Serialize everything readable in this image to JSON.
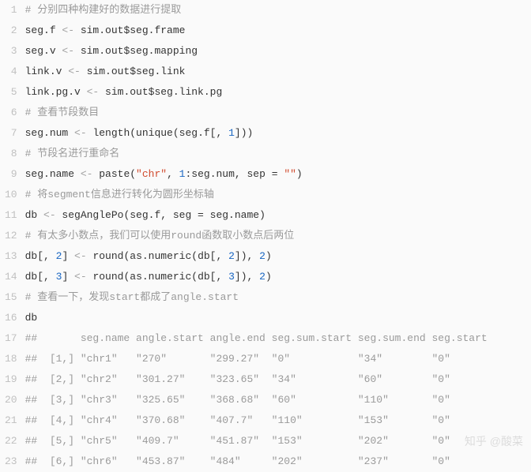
{
  "code": {
    "line_count": 23,
    "lines": [
      [
        {
          "t": "# 分别四种构建好的数据进行提取",
          "cls": "tok-comment"
        }
      ],
      [
        {
          "t": "seg.f ",
          "cls": "tok-ident"
        },
        {
          "t": "<-",
          "cls": "tok-op"
        },
        {
          "t": " sim.out$seg.frame",
          "cls": "tok-ident"
        }
      ],
      [
        {
          "t": "seg.v ",
          "cls": "tok-ident"
        },
        {
          "t": "<-",
          "cls": "tok-op"
        },
        {
          "t": " sim.out$seg.mapping",
          "cls": "tok-ident"
        }
      ],
      [
        {
          "t": "link.v ",
          "cls": "tok-ident"
        },
        {
          "t": "<-",
          "cls": "tok-op"
        },
        {
          "t": " sim.out$seg.link",
          "cls": "tok-ident"
        }
      ],
      [
        {
          "t": "link.pg.v ",
          "cls": "tok-ident"
        },
        {
          "t": "<-",
          "cls": "tok-op"
        },
        {
          "t": " sim.out$seg.link.pg",
          "cls": "tok-ident"
        }
      ],
      [
        {
          "t": "# 查看节段数目",
          "cls": "tok-comment"
        }
      ],
      [
        {
          "t": "seg.num ",
          "cls": "tok-ident"
        },
        {
          "t": "<-",
          "cls": "tok-op"
        },
        {
          "t": " length(unique(seg.f[, ",
          "cls": "tok-ident"
        },
        {
          "t": "1",
          "cls": "tok-num"
        },
        {
          "t": "]))",
          "cls": "tok-ident"
        }
      ],
      [
        {
          "t": "# 节段名进行重命名",
          "cls": "tok-comment"
        }
      ],
      [
        {
          "t": "seg.name ",
          "cls": "tok-ident"
        },
        {
          "t": "<-",
          "cls": "tok-op"
        },
        {
          "t": " paste(",
          "cls": "tok-ident"
        },
        {
          "t": "\"chr\"",
          "cls": "tok-str"
        },
        {
          "t": ", ",
          "cls": "tok-ident"
        },
        {
          "t": "1",
          "cls": "tok-num"
        },
        {
          "t": ":seg.num, sep = ",
          "cls": "tok-ident"
        },
        {
          "t": "\"\"",
          "cls": "tok-str"
        },
        {
          "t": ")",
          "cls": "tok-ident"
        }
      ],
      [
        {
          "t": "# 将segment信息进行转化为圆形坐标轴",
          "cls": "tok-comment"
        }
      ],
      [
        {
          "t": "db ",
          "cls": "tok-ident"
        },
        {
          "t": "<-",
          "cls": "tok-op"
        },
        {
          "t": " segAnglePo(seg.f, seg = seg.name)",
          "cls": "tok-ident"
        }
      ],
      [
        {
          "t": "# 有太多小数点，我们可以使用round函数取小数点后两位",
          "cls": "tok-comment"
        }
      ],
      [
        {
          "t": "db[, ",
          "cls": "tok-ident"
        },
        {
          "t": "2",
          "cls": "tok-num"
        },
        {
          "t": "] ",
          "cls": "tok-ident"
        },
        {
          "t": "<-",
          "cls": "tok-op"
        },
        {
          "t": " round(as.numeric(db[, ",
          "cls": "tok-ident"
        },
        {
          "t": "2",
          "cls": "tok-num"
        },
        {
          "t": "]), ",
          "cls": "tok-ident"
        },
        {
          "t": "2",
          "cls": "tok-num"
        },
        {
          "t": ")",
          "cls": "tok-ident"
        }
      ],
      [
        {
          "t": "db[, ",
          "cls": "tok-ident"
        },
        {
          "t": "3",
          "cls": "tok-num"
        },
        {
          "t": "] ",
          "cls": "tok-ident"
        },
        {
          "t": "<-",
          "cls": "tok-op"
        },
        {
          "t": " round(as.numeric(db[, ",
          "cls": "tok-ident"
        },
        {
          "t": "3",
          "cls": "tok-num"
        },
        {
          "t": "]), ",
          "cls": "tok-ident"
        },
        {
          "t": "2",
          "cls": "tok-num"
        },
        {
          "t": ")",
          "cls": "tok-ident"
        }
      ],
      [
        {
          "t": "# 查看一下，发现start都成了angle.start",
          "cls": "tok-comment"
        }
      ],
      [
        {
          "t": "db",
          "cls": "tok-ident"
        }
      ],
      [
        {
          "t": "##       seg.name angle.start angle.end seg.sum.start seg.sum.end seg.start",
          "cls": "tok-output"
        }
      ],
      [
        {
          "t": "##  [1,] \"chr1\"   \"270\"       \"299.27\"  \"0\"           \"34\"        \"0\"",
          "cls": "tok-output"
        }
      ],
      [
        {
          "t": "##  [2,] \"chr2\"   \"301.27\"    \"323.65\"  \"34\"          \"60\"        \"0\"",
          "cls": "tok-output"
        }
      ],
      [
        {
          "t": "##  [3,] \"chr3\"   \"325.65\"    \"368.68\"  \"60\"          \"110\"       \"0\"",
          "cls": "tok-output"
        }
      ],
      [
        {
          "t": "##  [4,] \"chr4\"   \"370.68\"    \"407.7\"   \"110\"         \"153\"       \"0\"",
          "cls": "tok-output"
        }
      ],
      [
        {
          "t": "##  [5,] \"chr5\"   \"409.7\"     \"451.87\"  \"153\"         \"202\"       \"0\"",
          "cls": "tok-output"
        }
      ],
      [
        {
          "t": "##  [6,] \"chr6\"   \"453.87\"    \"484\"     \"202\"         \"237\"       \"0\"",
          "cls": "tok-output"
        }
      ]
    ]
  },
  "watermark": "知乎 @酸菜"
}
